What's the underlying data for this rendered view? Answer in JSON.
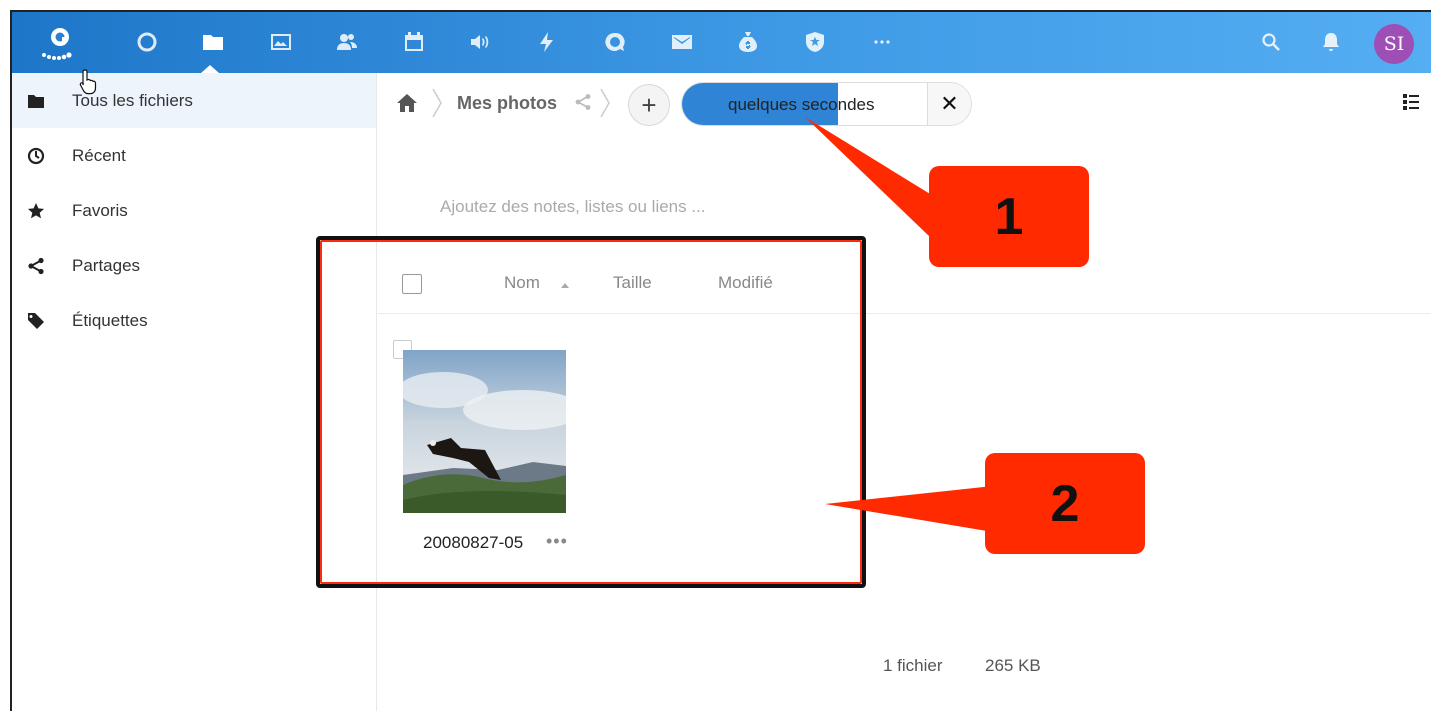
{
  "header": {
    "nav_icons": [
      "circle-icon",
      "folder-icon",
      "image-icon",
      "contacts-icon",
      "calendar-icon",
      "audio-icon",
      "activity-icon",
      "talk-icon",
      "mail-icon",
      "money-bag-icon",
      "shield-icon",
      "more-icon"
    ],
    "right_icons": [
      "search-icon",
      "bell-icon"
    ],
    "avatar_initials": "SI",
    "accent_color": "#2f84d6",
    "avatar_color": "#9d4fb5"
  },
  "sidebar": {
    "items": [
      {
        "label": "Tous les fichiers",
        "icon": "folder-icon"
      },
      {
        "label": "Récent",
        "icon": "clock-icon"
      },
      {
        "label": "Favoris",
        "icon": "star-icon"
      },
      {
        "label": "Partages",
        "icon": "share-icon"
      },
      {
        "label": "Étiquettes",
        "icon": "tag-icon"
      }
    ]
  },
  "breadcrumb": {
    "current": "Mes photos"
  },
  "upload": {
    "status": "quelques secondes",
    "progress": 0.54
  },
  "notes_placeholder": "Ajoutez des notes, listes ou liens ...",
  "table": {
    "columns": [
      "Nom",
      "Taille",
      "Modifié"
    ]
  },
  "files": [
    {
      "name": "20080827-05",
      "more": "•••"
    }
  ],
  "summary": {
    "count": "1 fichier",
    "size": "265 KB"
  },
  "annotations": {
    "callout_1": "1",
    "callout_2": "2",
    "callout_color": "#ff2a00"
  }
}
